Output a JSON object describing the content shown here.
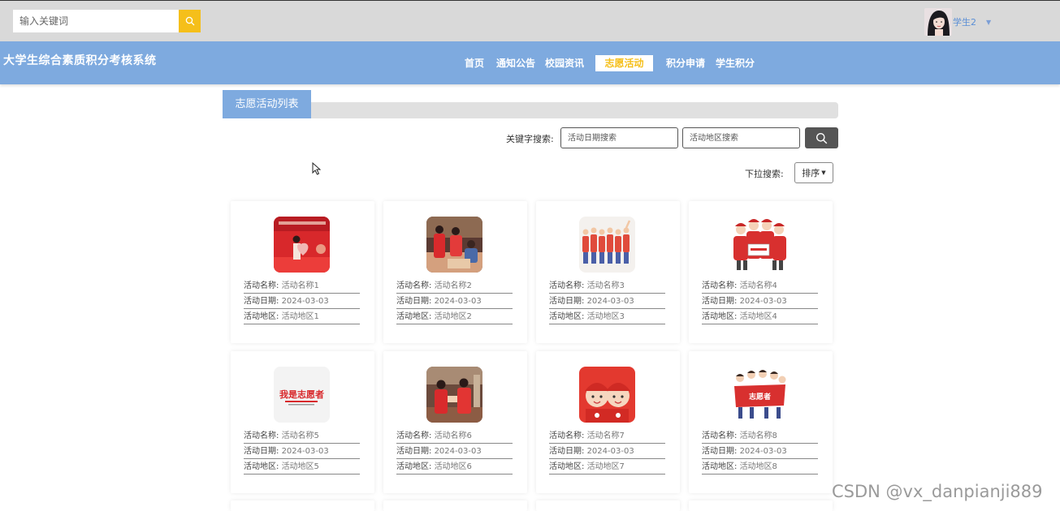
{
  "header": {
    "search_placeholder": "输入关键词",
    "username": "学生2"
  },
  "navbar": {
    "site_title": "大学生综合素质积分考核系统",
    "items": [
      {
        "label": "首页",
        "active": false
      },
      {
        "label": "通知公告",
        "active": false
      },
      {
        "label": "校园资讯",
        "active": false
      },
      {
        "label": "志愿活动",
        "active": true
      },
      {
        "label": "积分申请",
        "active": false
      },
      {
        "label": "学生积分",
        "active": false
      }
    ]
  },
  "section": {
    "title": "志愿活动列表"
  },
  "filters": {
    "keyword_label": "关键字搜索:",
    "date_placeholder": "活动日期搜索",
    "region_placeholder": "活动地区搜索",
    "dropdown_label": "下拉搜索:",
    "sort_label": "排序"
  },
  "field_labels": {
    "name": "活动名称:",
    "date": "活动日期:",
    "region": "活动地区:"
  },
  "cards": [
    {
      "name": "活动名称1",
      "date": "2024-03-03",
      "region": "活动地区1",
      "image": "volunteer-stage-photo"
    },
    {
      "name": "活动名称2",
      "date": "2024-03-03",
      "region": "活动地区2",
      "image": "volunteer-service-photo"
    },
    {
      "name": "活动名称3",
      "date": "2024-03-03",
      "region": "活动地区3",
      "image": "volunteer-crowd-illustration"
    },
    {
      "name": "活动名称4",
      "date": "2024-03-03",
      "region": "活动地区4",
      "image": "volunteer-group-illustration"
    },
    {
      "name": "活动名称5",
      "date": "2024-03-03",
      "region": "活动地区5",
      "image": "volunteer-logo-text"
    },
    {
      "name": "活动名称6",
      "date": "2024-03-03",
      "region": "活动地区6",
      "image": "volunteer-helping-photo"
    },
    {
      "name": "活动名称7",
      "date": "2024-03-03",
      "region": "活动地区7",
      "image": "volunteer-kids-illustration"
    },
    {
      "name": "活动名称8",
      "date": "2024-03-03",
      "region": "活动地区8",
      "image": "volunteer-banner-illustration"
    }
  ],
  "image_texts": {
    "logo": "我是志愿者",
    "banner": "志愿者"
  },
  "watermark": "CSDN @vx_danpianji889",
  "colors": {
    "nav_bg": "#7eaadf",
    "accent": "#f5bf1a",
    "topbar_bg": "#d9d9d9"
  }
}
